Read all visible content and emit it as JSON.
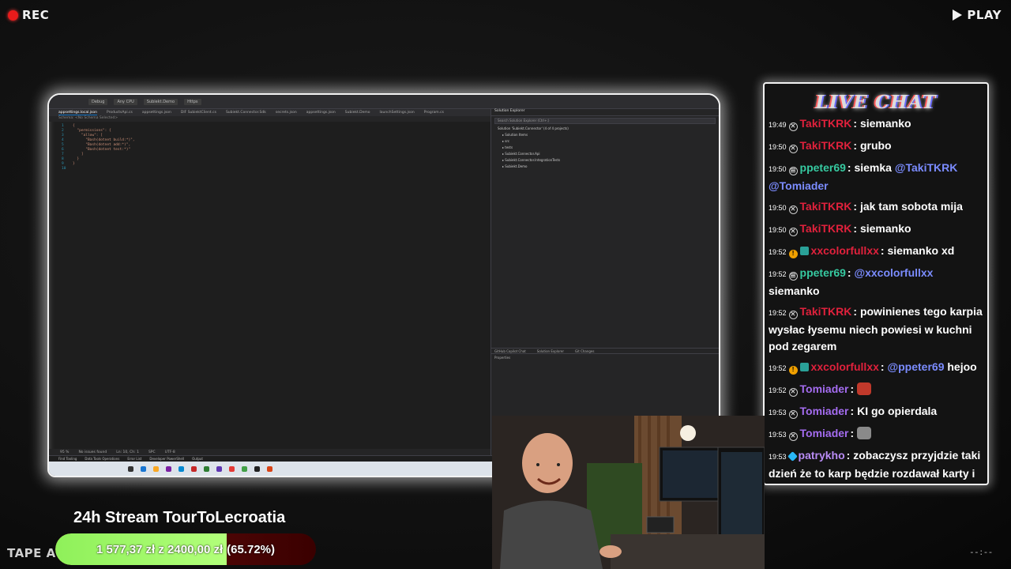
{
  "overlay": {
    "rec_label": "REC",
    "play_label": "PLAY",
    "tape_label": "TAPE A",
    "counter": "--:--"
  },
  "chat": {
    "title": "LIVE CHAT",
    "messages": [
      {
        "time": "19:49",
        "badge": "mod",
        "user": "TakiTKRK",
        "user_color": "#e0213c",
        "parts": [
          {
            "t": "siemanko"
          }
        ]
      },
      {
        "time": "19:50",
        "badge": "mod",
        "user": "TakiTKRK",
        "user_color": "#e0213c",
        "parts": [
          {
            "t": "grubo"
          }
        ]
      },
      {
        "time": "19:50",
        "badge": "sub",
        "user": "ppeter69",
        "user_color": "#36c9a0",
        "parts": [
          {
            "t": "siemka "
          },
          {
            "m": "@TakiTKRK"
          },
          {
            "t": " "
          },
          {
            "m": "@Tomiader"
          }
        ]
      },
      {
        "time": "19:50",
        "badge": "mod",
        "user": "TakiTKRK",
        "user_color": "#e0213c",
        "parts": [
          {
            "t": "jak tam sobota mija"
          }
        ]
      },
      {
        "time": "19:50",
        "badge": "mod",
        "user": "TakiTKRK",
        "user_color": "#e0213c",
        "parts": [
          {
            "t": "siemanko"
          }
        ]
      },
      {
        "time": "19:52",
        "badge": "vip",
        "user": "xxcolorfullxx",
        "user_color": "#e0213c",
        "parts": [
          {
            "t": "siemanko xd"
          }
        ]
      },
      {
        "time": "19:52",
        "badge": "sub",
        "user": "ppeter69",
        "user_color": "#36c9a0",
        "parts": [
          {
            "m": "@xxcolorfullxx"
          },
          {
            "t": " siemanko"
          }
        ]
      },
      {
        "time": "19:52",
        "badge": "mod",
        "user": "TakiTKRK",
        "user_color": "#e0213c",
        "parts": [
          {
            "t": "powinienes tego karpia wysłac łysemu niech powiesi w kuchni pod zegarem"
          }
        ]
      },
      {
        "time": "19:52",
        "badge": "vip",
        "user": "xxcolorfullxx",
        "user_color": "#e0213c",
        "parts": [
          {
            "m": "@ppeter69"
          },
          {
            "t": " hejoo"
          }
        ]
      },
      {
        "time": "19:52",
        "badge": "mod",
        "user": "Tomiader",
        "user_color": "#a46cf0",
        "parts": [
          {
            "e": "#c0392b"
          }
        ]
      },
      {
        "time": "19:53",
        "badge": "mod",
        "user": "Tomiader",
        "user_color": "#a46cf0",
        "parts": [
          {
            "t": "KI go opierdala"
          }
        ]
      },
      {
        "time": "19:53",
        "badge": "mod",
        "user": "Tomiader",
        "user_color": "#a46cf0",
        "parts": [
          {
            "e": "#8a8a8a"
          }
        ]
      },
      {
        "time": "19:53",
        "badge": "dia",
        "user": "patrykho",
        "user_color": "#b98cf5",
        "parts": [
          {
            "t": "zobaczysz przyjdzie taki dzień że to karp będzie rozdawał karty i to on będzie z nożem stał przy łóżku"
          }
        ]
      }
    ]
  },
  "goal": {
    "title": "24h Stream TourToLecroatia",
    "amount": "1 577,37 zł z 2400,00 zł",
    "percent_label": "(65.72%)",
    "progress": 0.6572
  },
  "ide": {
    "toolbar": [
      "Debug",
      "Any CPU",
      "Subiekt.Demo",
      "Https"
    ],
    "tabs": [
      "appsettings.local.json",
      "ProductsApi.cs",
      "appsettings.json",
      "DIF SubiektClient.cs",
      "Subiekt.Connector.Sdk",
      "secrets.json",
      "appsettings.json",
      "Subiekt.Demo",
      "launchSettings.json",
      "Program.cs"
    ],
    "schema": "Schema: <No Schema Selected>",
    "code_lines": [
      "{",
      "  \"permissions\": {",
      "    \"allow\": [",
      "      \"Bash(dotnet build:*)\",",
      "      \"Bash(dotnet add:*)\",",
      "      \"Bash(dotnet test:*)\"",
      "    ]",
      "  }",
      "}",
      ""
    ],
    "editor_status": [
      "95 %",
      "No issues found",
      "Ln: 10, Ch: 1",
      "SPC",
      "UTF-8"
    ],
    "solution_title": "Solution Explorer",
    "solution_search": "Search Solution Explorer (Ctrl+;)",
    "solution_tree": [
      "Solution 'Subiekt.Connector' (4 of 4 projects)",
      "Solution Items",
      "src",
      "tests",
      "Subiekt.Connector.Api",
      "Subiekt.Connector.IntegrationTests",
      "Subiekt.Demo"
    ],
    "solution_tabs": [
      "GitHub Copilot Chat",
      "Solution Explorer",
      "Git Changes"
    ],
    "properties_label": "Properties",
    "footer_tabs": [
      "Find Tooling",
      "Data Tools Operations",
      "Error List",
      "Developer PowerShell",
      "Output"
    ],
    "ready": "Ready"
  }
}
